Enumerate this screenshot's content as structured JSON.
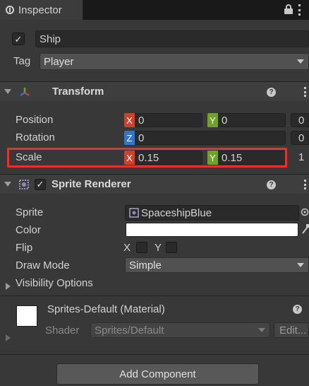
{
  "window": {
    "tab_title": "Inspector"
  },
  "gameobject": {
    "active": true,
    "name": "Ship",
    "tag_label": "Tag",
    "tag_value": "Player"
  },
  "transform": {
    "title": "Transform",
    "position_label": "Position",
    "position_x": "0",
    "position_y": "0",
    "position_z_partial": "0",
    "rotation_label": "Rotation",
    "rotation_z": "0",
    "rotation_trailing": "0",
    "scale_label": "Scale",
    "scale_x": "0.15",
    "scale_y": "0.15",
    "scale_trailing": "1",
    "axis_x": "X",
    "axis_y": "Y",
    "axis_z": "Z"
  },
  "sprite_renderer": {
    "title": "Sprite Renderer",
    "enabled": true,
    "sprite_label": "Sprite",
    "sprite_value": "SpaceshipBlue",
    "color_label": "Color",
    "color_value": "#ffffff",
    "flip_label": "Flip",
    "flip_x_label": "X",
    "flip_y_label": "Y",
    "draw_mode_label": "Draw Mode",
    "draw_mode_value": "Simple",
    "visibility_label": "Visibility Options"
  },
  "material": {
    "name": "Sprites-Default (Material)",
    "shader_label": "Shader",
    "shader_value": "Sprites/Default",
    "edit_label": "Edit..."
  },
  "footer": {
    "add_component_label": "Add Component"
  },
  "icons": {
    "lock": "lock-icon",
    "menu": "kebab-menu-icon",
    "transform": "transform-axes-icon",
    "sprite_renderer": "sprite-renderer-icon",
    "help": "help-icon",
    "presets": "presets-icon",
    "sprite": "sprite-asset-icon",
    "picker": "object-picker-icon",
    "eyedropper": "eyedropper-icon"
  },
  "colors": {
    "highlight": "#e5322d",
    "axis_x": "#c8442e",
    "axis_y": "#6ea22d",
    "axis_z": "#3675c4"
  }
}
